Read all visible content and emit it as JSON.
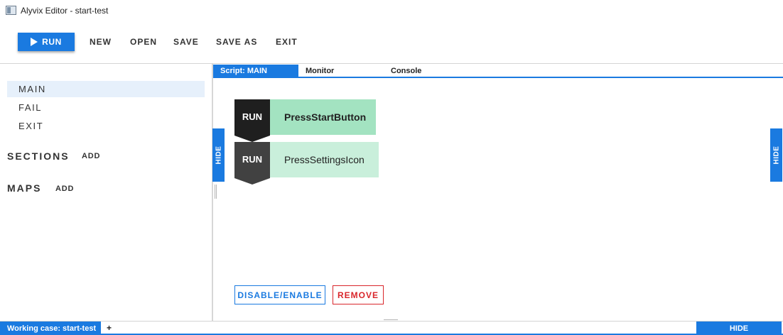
{
  "window": {
    "title": "Alyvix Editor - start-test"
  },
  "toolbar": {
    "run_label": "RUN",
    "new_label": "NEW",
    "open_label": "OPEN",
    "save_label": "SAVE",
    "save_as_label": "SAVE AS",
    "exit_label": "EXIT"
  },
  "sidebar": {
    "items": [
      {
        "label": "MAIN",
        "active": true
      },
      {
        "label": "FAIL",
        "active": false
      },
      {
        "label": "EXIT",
        "active": false
      }
    ],
    "sections_label": "SECTIONS",
    "sections_add": "ADD",
    "maps_label": "MAPS",
    "maps_add": "ADD"
  },
  "tabs": [
    {
      "label": "Script: MAIN",
      "active": true
    },
    {
      "label": "Monitor",
      "active": false
    },
    {
      "label": "Console",
      "active": false
    }
  ],
  "side_hide_label": "HIDE",
  "script_blocks": [
    {
      "tag": "RUN",
      "name": "PressStartButton",
      "tag_color": "#1f1f1f",
      "name_bg": "#a3e3c1",
      "bold": true
    },
    {
      "tag": "RUN",
      "name": "PressSettingsIcon",
      "tag_color": "#414141",
      "name_bg": "#c9efdb",
      "bold": false
    }
  ],
  "actions": {
    "disable_enable_label": "DISABLE/ENABLE",
    "remove_label": "REMOVE"
  },
  "statusbar": {
    "working_case": "Working case: start-test",
    "add_label": "+",
    "hide_label": "HIDE"
  },
  "colors": {
    "accent": "#1a7ae0",
    "remove": "#d9262b"
  }
}
